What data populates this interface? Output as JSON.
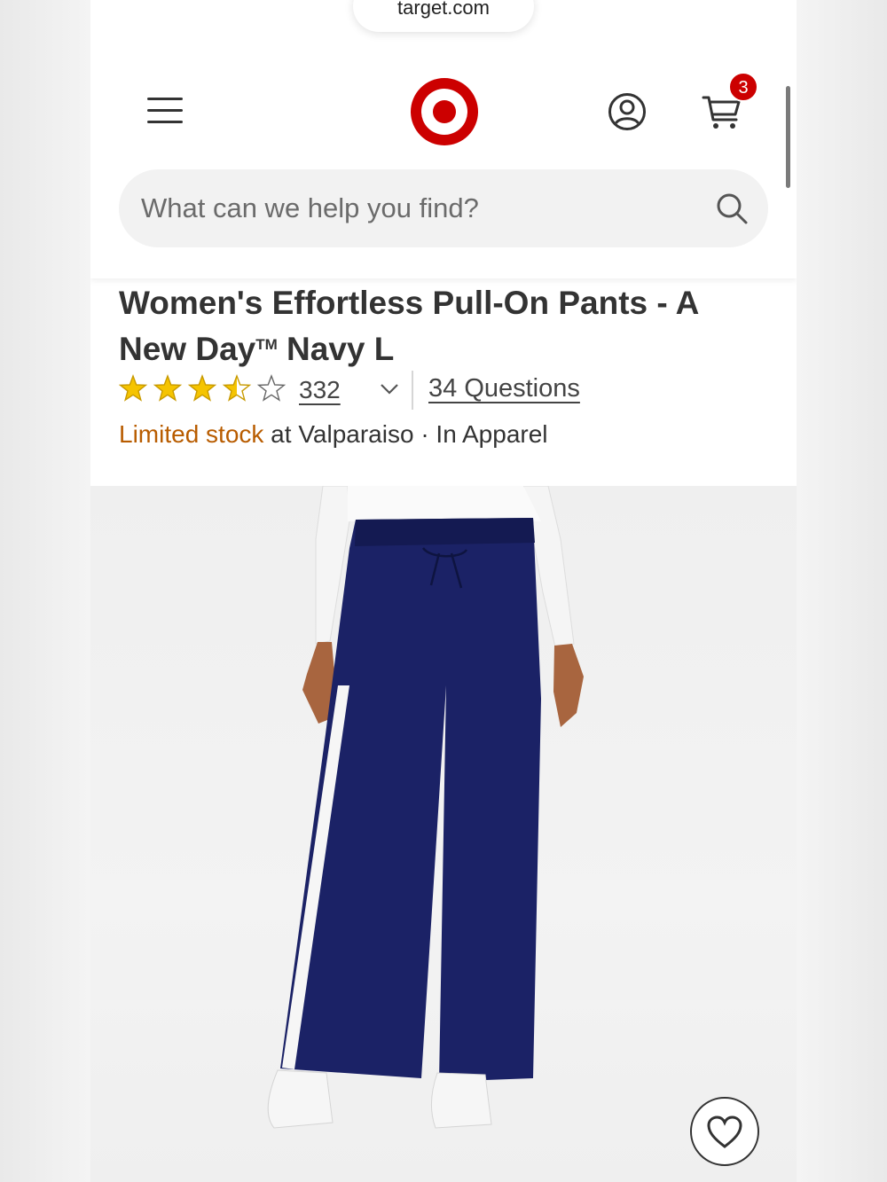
{
  "browser": {
    "url": "target.com"
  },
  "header": {
    "cart_count": "3",
    "search_placeholder": "What can we help you find?",
    "brand_color": "#cc0000"
  },
  "product": {
    "title_main": "Women's Effortless Pull-On Pants - A New Day",
    "title_tm": "TM",
    "title_tail": " Navy L",
    "rating": 3.5,
    "rating_max": 5,
    "review_count": "332",
    "questions_label": "34 Questions",
    "stock_status": "Limited stock",
    "stock_location": " at Valparaiso · In Apparel",
    "stock_color": "#b85c00"
  },
  "icons": [
    "hamburger-menu-icon",
    "target-logo",
    "account-icon",
    "cart-icon",
    "search-icon",
    "star-icon",
    "chevron-down-icon",
    "heart-icon"
  ]
}
